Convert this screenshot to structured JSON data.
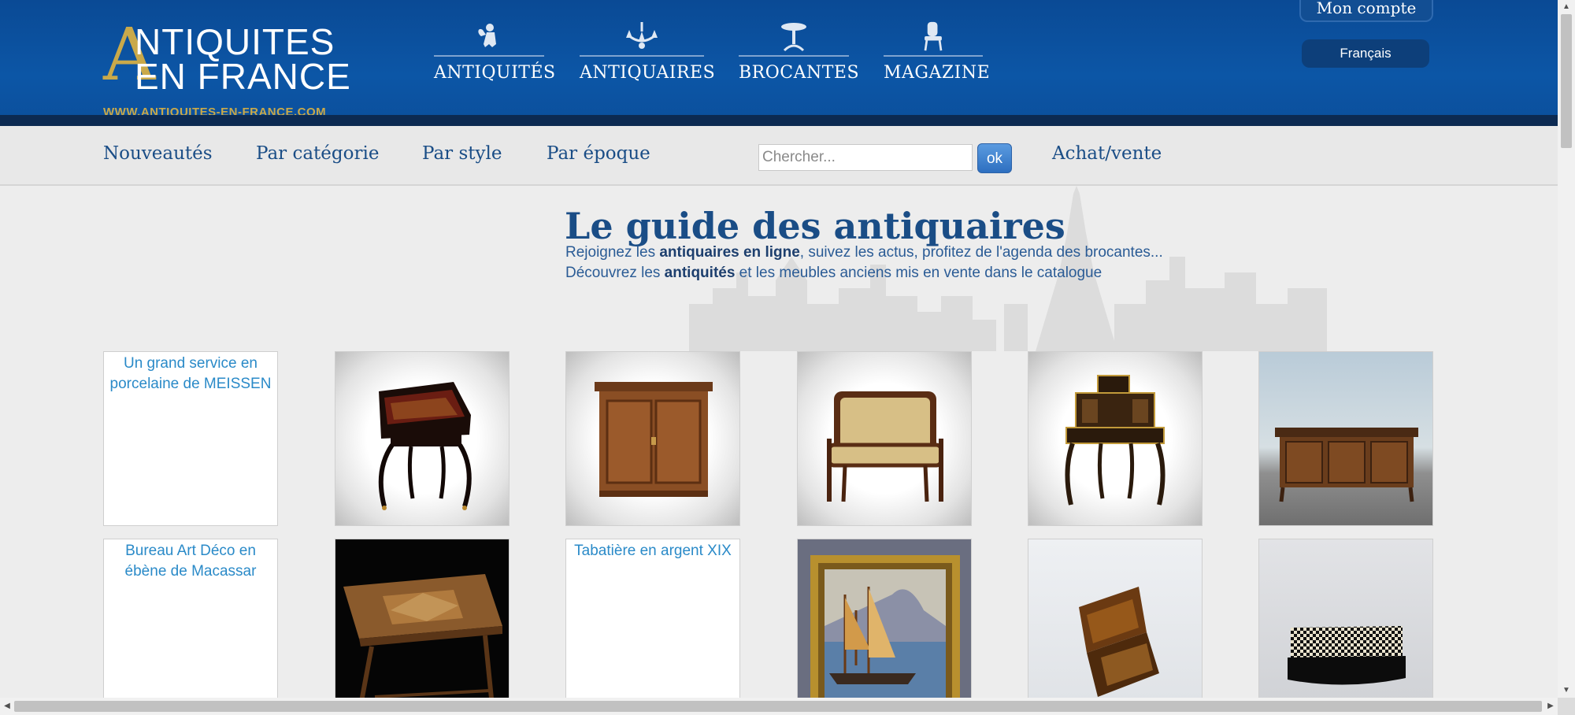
{
  "header": {
    "logo": {
      "letter": "A",
      "line1": "NTIQUITES",
      "line2": "EN FRANCE",
      "url": "WWW.ANTIQUITES-EN-FRANCE.COM"
    },
    "nav": [
      {
        "label": "ANTIQUITÉS",
        "icon": "cherub-icon"
      },
      {
        "label": "ANTIQUAIRES",
        "icon": "chandelier-icon"
      },
      {
        "label": "BROCANTES",
        "icon": "pedestal-table-icon"
      },
      {
        "label": "MAGAZINE",
        "icon": "chair-icon"
      }
    ],
    "account_label": "Mon compte",
    "language_label": "Français"
  },
  "subnav": {
    "items": [
      "Nouveautés",
      "Par catégorie",
      "Par style",
      "Par époque"
    ],
    "search_placeholder": "Chercher...",
    "search_button": "ok",
    "buy_sell": "Achat/vente"
  },
  "hero": {
    "title": "Le guide des antiquaires",
    "line1": {
      "pre": "Rejoignez les ",
      "bold": "antiquaires en ligne",
      "post": ", suivez les actus, profitez de l'agenda des brocantes..."
    },
    "line2": {
      "pre": "Découvrez les ",
      "bold": "antiquités",
      "post": " et les meubles anciens mis en vente dans le catalogue"
    }
  },
  "products": {
    "row1": [
      {
        "alt": "Un grand service en porcelaine de MEISSEN",
        "broken": true
      },
      {
        "kind": "boulle-lady-desk",
        "broken": false
      },
      {
        "kind": "walnut-cabinet",
        "broken": false
      },
      {
        "kind": "settee",
        "broken": false
      },
      {
        "kind": "bonheur-du-jour-desk",
        "broken": false
      },
      {
        "kind": "carved-sideboard",
        "broken": false
      }
    ],
    "row2": [
      {
        "alt": "Bureau Art Déco en ébène de Macassar",
        "broken": true
      },
      {
        "kind": "marquetry-table",
        "broken": false
      },
      {
        "alt": "Tabatière en argent XIX",
        "broken": true
      },
      {
        "kind": "harbour-painting",
        "broken": false
      },
      {
        "kind": "tortoiseshell-box",
        "broken": false
      },
      {
        "kind": "checkered-box",
        "broken": false
      }
    ]
  },
  "colors": {
    "header_blue": "#0c56a6",
    "gold": "#c9a94a",
    "link_blue": "#1a4d86",
    "alt_text_blue": "#2a8ac8"
  }
}
